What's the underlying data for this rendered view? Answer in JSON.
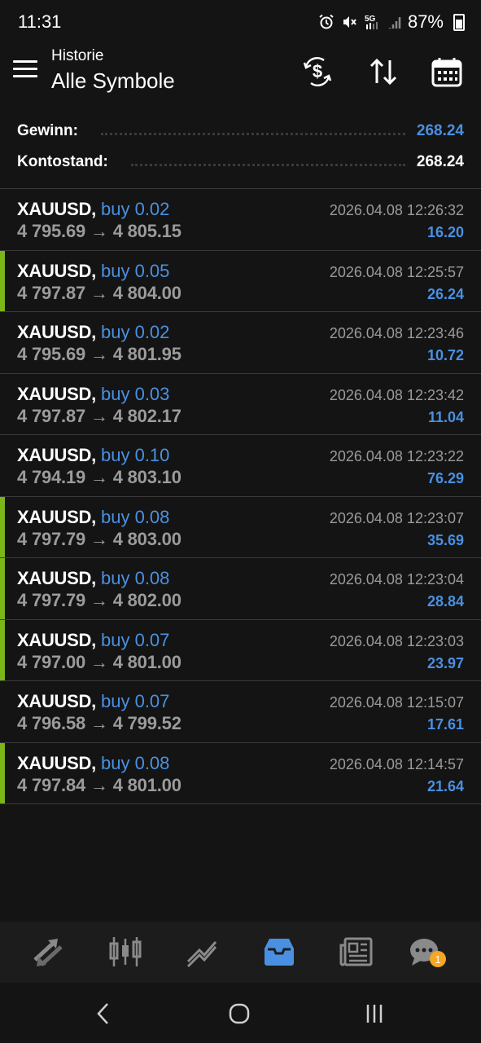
{
  "status_bar": {
    "time": "11:31",
    "network": "5G",
    "battery": "87%"
  },
  "header": {
    "subtitle": "Historie",
    "title": "Alle Symbole",
    "actions": [
      "currency-exchange-icon",
      "sort-icon",
      "calendar-icon"
    ]
  },
  "summary": {
    "profit_label": "Gewinn:",
    "profit_value": "268.24",
    "balance_label": "Kontostand:",
    "balance_value": "268.24"
  },
  "colors": {
    "background": "#141414",
    "accent_blue": "#4a90e2",
    "marker_green": "#7cb518",
    "text_gray": "#9b9b9b",
    "badge_orange": "#f5a623"
  },
  "deals": [
    {
      "symbol": "XAUUSD,",
      "type": "buy 0.02",
      "open": "4 795.69",
      "arrow": "→",
      "close": "4 805.15",
      "time": "2026.04.08 12:26:32",
      "profit": "16.20",
      "marked": false
    },
    {
      "symbol": "XAUUSD,",
      "type": "buy 0.05",
      "open": "4 797.87",
      "arrow": "→",
      "close": "4 804.00",
      "time": "2026.04.08 12:25:57",
      "profit": "26.24",
      "marked": true
    },
    {
      "symbol": "XAUUSD,",
      "type": "buy 0.02",
      "open": "4 795.69",
      "arrow": "→",
      "close": "4 801.95",
      "time": "2026.04.08 12:23:46",
      "profit": "10.72",
      "marked": false
    },
    {
      "symbol": "XAUUSD,",
      "type": "buy 0.03",
      "open": "4 797.87",
      "arrow": "→",
      "close": "4 802.17",
      "time": "2026.04.08 12:23:42",
      "profit": "11.04",
      "marked": false
    },
    {
      "symbol": "XAUUSD,",
      "type": "buy 0.10",
      "open": "4 794.19",
      "arrow": "→",
      "close": "4 803.10",
      "time": "2026.04.08 12:23:22",
      "profit": "76.29",
      "marked": false
    },
    {
      "symbol": "XAUUSD,",
      "type": "buy 0.08",
      "open": "4 797.79",
      "arrow": "→",
      "close": "4 803.00",
      "time": "2026.04.08 12:23:07",
      "profit": "35.69",
      "marked": true
    },
    {
      "symbol": "XAUUSD,",
      "type": "buy 0.08",
      "open": "4 797.79",
      "arrow": "→",
      "close": "4 802.00",
      "time": "2026.04.08 12:23:04",
      "profit": "28.84",
      "marked": true
    },
    {
      "symbol": "XAUUSD,",
      "type": "buy 0.07",
      "open": "4 797.00",
      "arrow": "→",
      "close": "4 801.00",
      "time": "2026.04.08 12:23:03",
      "profit": "23.97",
      "marked": true
    },
    {
      "symbol": "XAUUSD,",
      "type": "buy 0.07",
      "open": "4 796.58",
      "arrow": "→",
      "close": "4 799.52",
      "time": "2026.04.08 12:15:07",
      "profit": "17.61",
      "marked": false
    },
    {
      "symbol": "XAUUSD,",
      "type": "buy 0.08",
      "open": "4 797.84",
      "arrow": "→",
      "close": "4 801.00",
      "time": "2026.04.08 12:14:57",
      "profit": "21.64",
      "marked": true
    }
  ],
  "bottom_nav": {
    "items": [
      "quotes-icon",
      "chart-icon",
      "trade-icon",
      "history-icon",
      "news-icon",
      "messages-icon"
    ],
    "active": "history-icon",
    "badge": "1"
  }
}
